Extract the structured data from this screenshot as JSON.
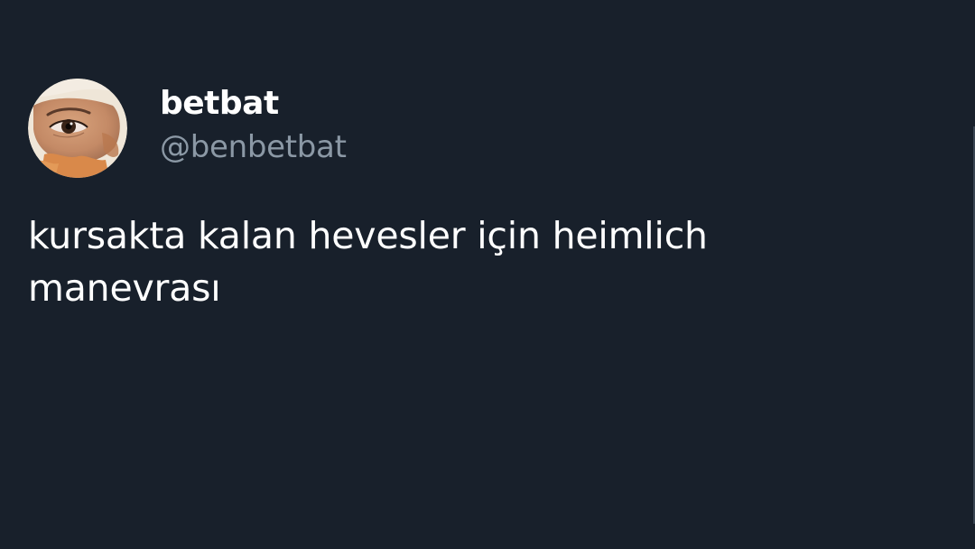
{
  "tweet": {
    "display_name": "betbat",
    "handle": "@benbetbat",
    "text": "kursakta kalan hevesler için heimlich\nmanevrası"
  },
  "colors": {
    "background": "#18202b",
    "text_primary": "#ffffff",
    "text_secondary": "#8b98a5"
  },
  "icons": {
    "avatar": "profile-photo-eye"
  }
}
